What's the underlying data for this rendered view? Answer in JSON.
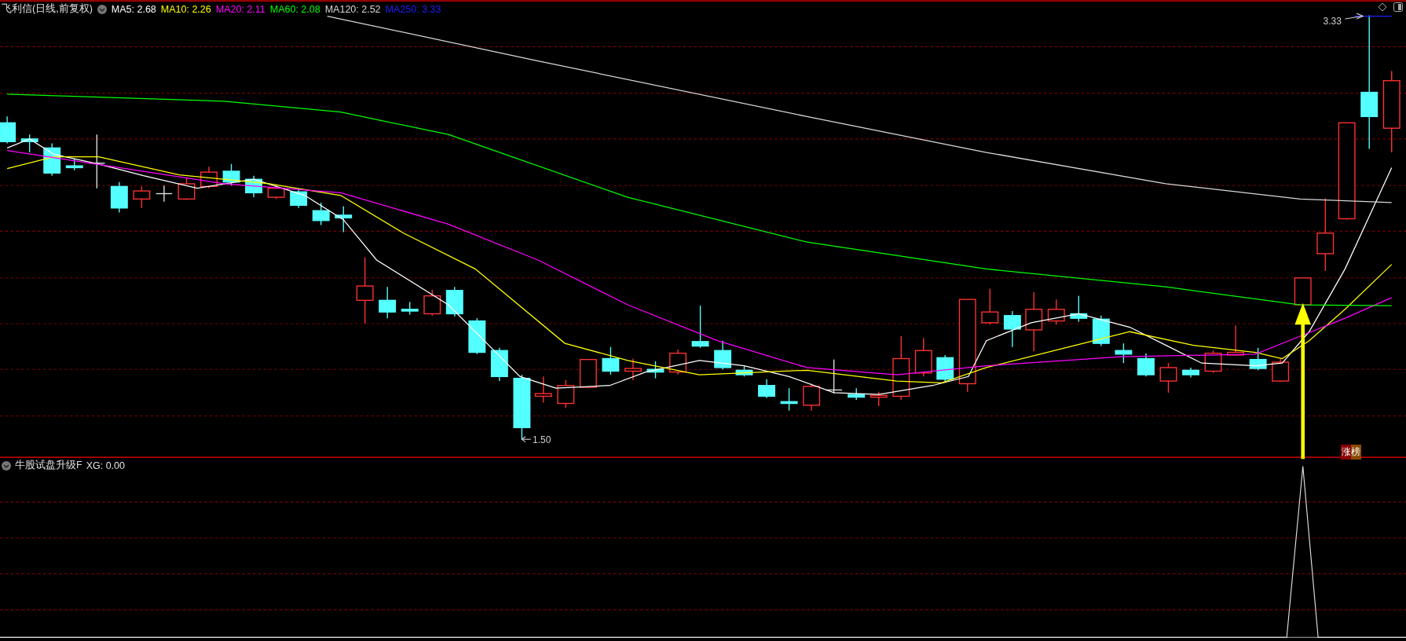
{
  "chart": {
    "title": "飞利信(日线,前复权)",
    "indicators": [
      {
        "label": "MA5: 2.68",
        "color": "#ffffff"
      },
      {
        "label": "MA10: 2.26",
        "color": "#ffff00"
      },
      {
        "label": "MA20: 2.11",
        "color": "#ff00ff"
      },
      {
        "label": "MA60: 2.08",
        "color": "#00ff00"
      },
      {
        "label": "MA120: 2.52",
        "color": "#d8d8d8"
      },
      {
        "label": "MA250: 3.33",
        "color": "#1e1eff"
      }
    ],
    "max_label": "3.33",
    "min_label": "1.50",
    "badge": "涨榜"
  },
  "lower_pane": {
    "title": "牛股试盘升级F",
    "reading": "XG: 0.00"
  }
}
